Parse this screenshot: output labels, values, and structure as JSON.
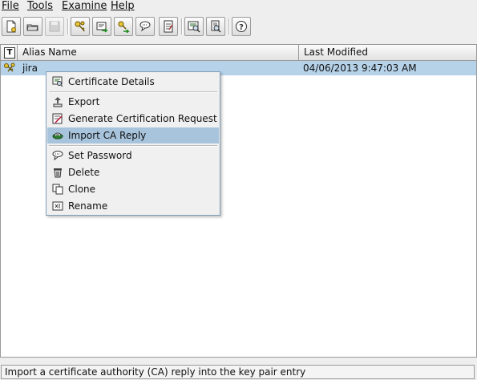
{
  "menubar": {
    "items": [
      {
        "label": "File"
      },
      {
        "label": "Tools"
      },
      {
        "label": "Examine"
      },
      {
        "label": "Help"
      }
    ]
  },
  "toolbar": {
    "buttons": [
      {
        "icon": "new-keystore-icon"
      },
      {
        "icon": "open-keystore-icon"
      },
      {
        "icon": "save-keystore-icon",
        "disabled": true
      },
      {
        "icon": "generate-key-pair-icon"
      },
      {
        "icon": "import-trusted-certificate-icon"
      },
      {
        "icon": "import-key-pair-icon"
      },
      {
        "icon": "set-keystore-password-icon"
      },
      {
        "icon": "keystore-report-icon"
      },
      {
        "icon": "examine-certificate-icon"
      },
      {
        "icon": "examine-crl-icon"
      },
      {
        "icon": "help-icon"
      }
    ]
  },
  "table": {
    "type_header": "T",
    "columns": [
      "Alias Name",
      "Last Modified"
    ],
    "rows": [
      {
        "alias": "jira",
        "last_modified": "04/06/2013 9:47:03 AM",
        "entry_type": "key-pair-icon",
        "selected": true
      }
    ]
  },
  "context_menu": {
    "items": [
      {
        "label": "Certificate Details",
        "icon": "certificate-icon"
      },
      {
        "label": "Export",
        "icon": "export-icon"
      },
      {
        "label": "Generate Certification Request",
        "icon": "generate-csr-icon"
      },
      {
        "label": "Import CA Reply",
        "icon": "import-ca-reply-icon",
        "selected": true
      },
      {
        "label": "Set Password",
        "icon": "set-password-icon"
      },
      {
        "label": "Delete",
        "icon": "delete-icon"
      },
      {
        "label": "Clone",
        "icon": "clone-icon"
      },
      {
        "label": "Rename",
        "icon": "rename-icon"
      }
    ]
  },
  "status_bar": {
    "text": "Import a certificate authority (CA) reply into the key pair entry"
  },
  "colors": {
    "selection": "#b6d2e9",
    "menu_selection": "#a8c4dc",
    "menu_border": "#7f9db9"
  }
}
